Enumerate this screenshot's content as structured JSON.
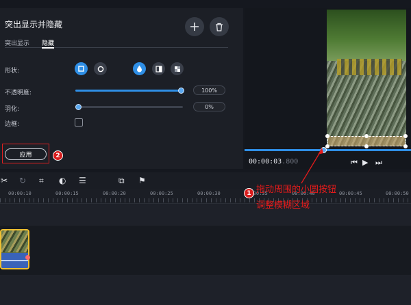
{
  "panel": {
    "title": "突出显示并隐藏",
    "tabs": [
      "突出显示",
      "隐藏"
    ],
    "active_tab": "隐藏",
    "shape_label": "形状:",
    "opacity_label": "不透明度:",
    "opacity_value": "100%",
    "feather_label": "羽化:",
    "feather_value": "0%",
    "border_label": "边框:",
    "apply_label": "应用",
    "apply_badge": "2"
  },
  "preview": {
    "time_main": "00:00:03",
    "time_ms": ".800"
  },
  "timeline": {
    "ticks": [
      "00:00:10",
      "00:00:15",
      "00:00:20",
      "00:00:25",
      "00:00:30",
      "00:00:35",
      "00:00:40",
      "00:00:45",
      "00:00:50"
    ]
  },
  "annotation": {
    "badge": "1",
    "line1": "拖动周围的小圆按钮",
    "line2": "调整模糊区域"
  },
  "levels": {
    "opacity": 1.0,
    "feather": 0.0
  },
  "colors": {
    "accent": "#2f8fe6",
    "annotation": "#e41b1b",
    "clip_border": "#f0c030"
  },
  "icons": [
    "plus-icon",
    "trash-icon",
    "square-shape-icon",
    "circle-shape-icon",
    "drop-icon",
    "split-icon",
    "mosaic-icon",
    "skip-back-icon",
    "play-icon",
    "skip-forward-icon",
    "scissors-icon",
    "redo-icon",
    "crop-icon",
    "color-icon",
    "adjust-icon",
    "overlay-icon",
    "flag-icon"
  ]
}
